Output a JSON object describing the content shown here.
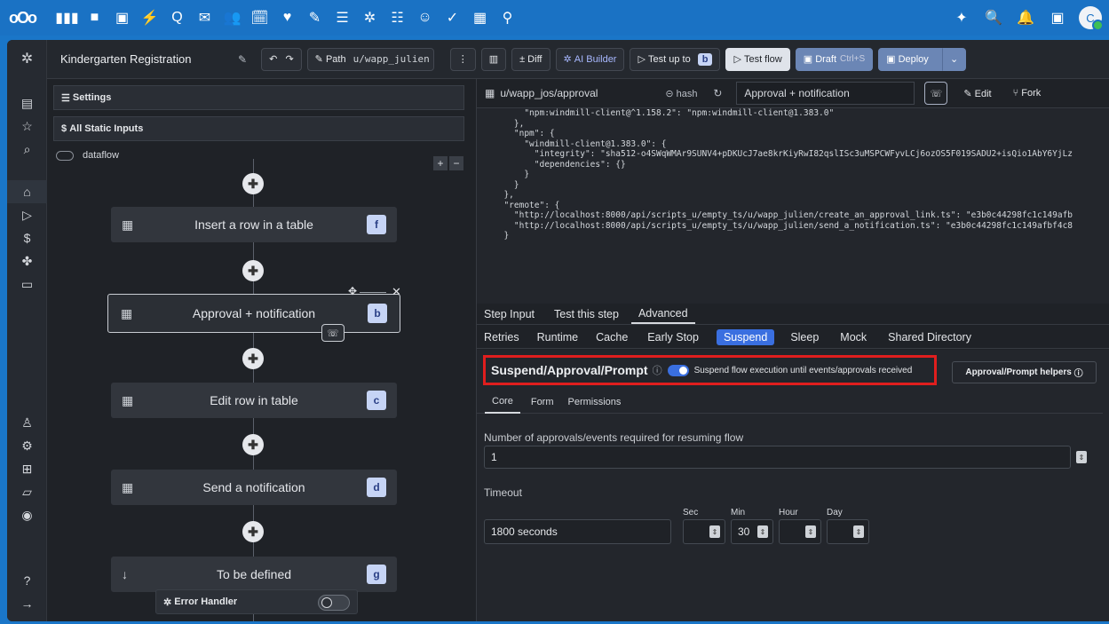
{
  "topbar": {
    "logo": "oOo",
    "apps": [
      "▮▮▮",
      "■",
      "▣",
      "⚡",
      "Q",
      "✉",
      "👥",
      "🗓",
      "♥",
      "✎",
      "☰",
      "✲",
      "☷",
      "☺",
      "✓",
      "▦",
      "⚲"
    ],
    "right_icons": [
      "✦",
      "🔍",
      "🔔",
      "▣"
    ],
    "avatar": "C"
  },
  "header": {
    "flow_name": "Kindergarten Registration",
    "path_label": "Path",
    "path_value": "u/wapp_julien",
    "diff": "± Diff",
    "ai_builder": "AI Builder",
    "test_up_to": "Test up to",
    "test_up_to_badge": "b",
    "test_flow": "Test flow",
    "draft": "Draft",
    "draft_kbd": "Ctrl+S",
    "deploy": "Deploy"
  },
  "flow": {
    "settings": "Settings",
    "static_inputs": "All Static Inputs",
    "dataflow": "dataflow",
    "nodes": [
      {
        "label": "Insert a row in a table",
        "tag": "f"
      },
      {
        "label": "Approval + notification",
        "tag": "b"
      },
      {
        "label": "Edit row in table",
        "tag": "c"
      },
      {
        "label": "Send a notification",
        "tag": "d"
      },
      {
        "label": "To be defined",
        "tag": "g"
      }
    ],
    "error_handler": "Error Handler"
  },
  "detail": {
    "path": "u/wapp_jos/approval",
    "hash": "hash",
    "summary": "Approval + notification",
    "edit": "Edit",
    "fork": "Fork",
    "code_lines": [
      "      \"npm:windmill-client@^1.158.2\": \"npm:windmill-client@1.383.0\"",
      "    },",
      "    \"npm\": {",
      "      \"windmill-client@1.383.0\": {",
      "        \"integrity\": \"sha512-o4SWqWMAr9SUNV4+pDKUcJ7ae8krKiyRwI82qslISc3uMSPCWFyvLCj6ozOS5F019SADU2+isQio1AbY6YjLz",
      "        \"dependencies\": {}",
      "      }",
      "    }",
      "  },",
      "  \"remote\": {",
      "    \"http://localhost:8000/api/scripts_u/empty_ts/u/wapp_julien/create_an_approval_link.ts\": \"e3b0c44298fc1c149afb",
      "    \"http://localhost:8000/api/scripts_u/empty_ts/u/wapp_julien/send_a_notification.ts\": \"e3b0c44298fc1c149afbf4c8",
      "  }"
    ],
    "tabs": [
      "Step Input",
      "Test this step",
      "Advanced"
    ],
    "subtabs": [
      "Retries",
      "Runtime",
      "Cache",
      "Early Stop",
      "Suspend",
      "Sleep",
      "Mock",
      "Shared Directory"
    ],
    "suspend_title": "Suspend/Approval/Prompt",
    "suspend_toggle_label": "Suspend flow execution until events/approvals received",
    "helpers": "Approval/Prompt helpers",
    "inner_tabs": [
      "Core",
      "Form",
      "Permissions"
    ],
    "approvals_label": "Number of approvals/events required for resuming flow",
    "approvals_value": "1",
    "timeout_label": "Timeout",
    "timeout_value": "1800 seconds",
    "units": [
      "Sec",
      "Min",
      "Hour",
      "Day"
    ],
    "min_value": "30"
  },
  "colors": {
    "accent": "#3a6fe0",
    "highlight_border": "#e01e1e",
    "brand": "#1a72c4"
  }
}
